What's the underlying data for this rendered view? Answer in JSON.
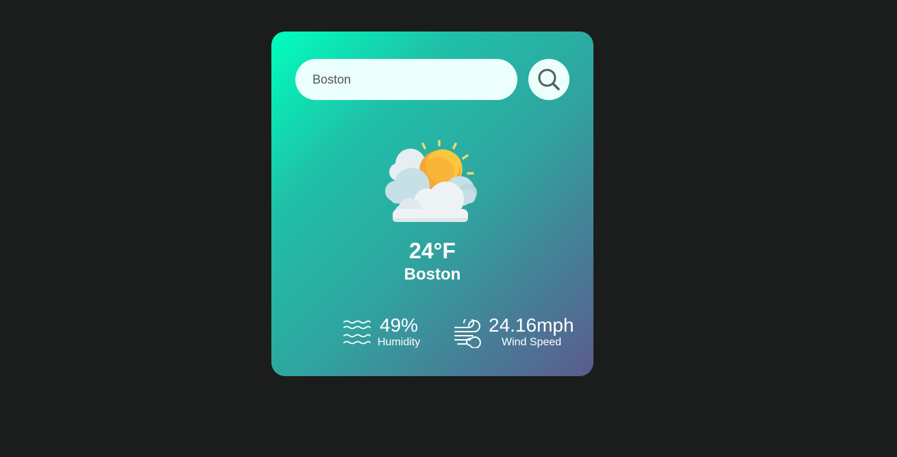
{
  "search": {
    "value": "Boston",
    "icon": "search-icon"
  },
  "weather": {
    "icon": "partly-cloudy-sun-icon",
    "temperature": "24°F",
    "city": "Boston"
  },
  "stats": {
    "humidity": {
      "icon": "waves-icon",
      "value": "49%",
      "label": "Humidity"
    },
    "wind": {
      "icon": "wind-icon",
      "value": "24.16mph",
      "label": "Wind Speed"
    }
  },
  "colors": {
    "background": "#1b1c1c",
    "card_gradient_start": "#00ffbd",
    "card_gradient_end": "#5b5b8e",
    "input_bg": "#ebfffc",
    "sun": "#f9c73e",
    "cloud": "#e8eef2"
  }
}
